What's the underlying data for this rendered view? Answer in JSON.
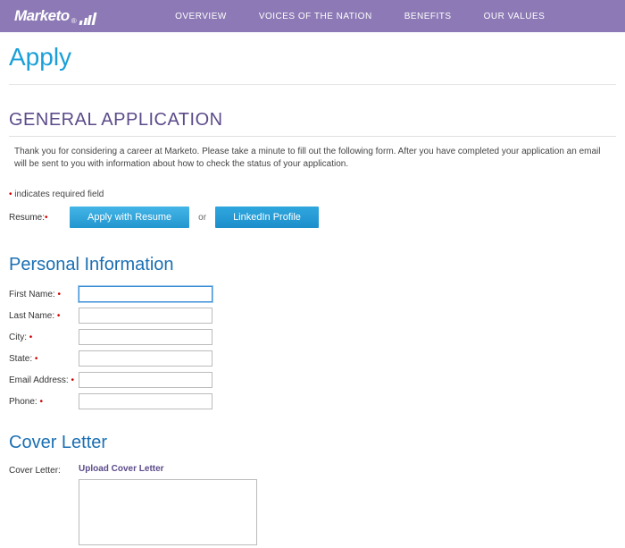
{
  "brand": {
    "name": "Marketo",
    "reg": "®"
  },
  "nav": {
    "overview": "OVERVIEW",
    "voices": "VOICES OF THE NATION",
    "benefits": "BENEFITS",
    "values": "OUR VALUES"
  },
  "page_title": "Apply",
  "general": {
    "heading": "GENERAL APPLICATION",
    "intro": "Thank you for considering a career at Marketo. Please take a minute to fill out the following form. After you have completed your application an email will be sent to you with information about how to check the status of your application.",
    "required_note": "indicates required field",
    "resume_label": "Resume:",
    "apply_btn": "Apply with Resume",
    "or": "or",
    "linkedin_btn": "LinkedIn Profile"
  },
  "personal": {
    "heading": "Personal Information",
    "first_name_label": "First Name:",
    "last_name_label": "Last Name:",
    "city_label": "City:",
    "state_label": "State:",
    "email_label": "Email Address:",
    "phone_label": "Phone:",
    "first_name_value": "",
    "last_name_value": "",
    "city_value": "",
    "state_value": "",
    "email_value": "",
    "phone_value": ""
  },
  "cover": {
    "heading": "Cover Letter",
    "label": "Cover Letter:",
    "upload": "Upload Cover Letter",
    "textarea_value": ""
  }
}
